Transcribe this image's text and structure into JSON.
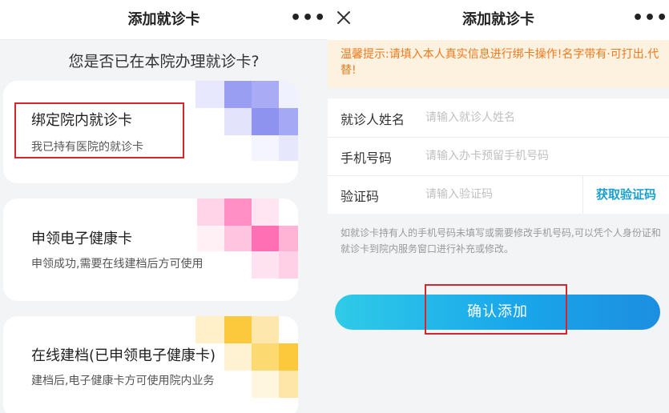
{
  "left_screen": {
    "title": "添加就诊卡",
    "more_icon": "more-horizontal-icon",
    "question": "您是否已在本院办理就诊卡?",
    "cards": [
      {
        "title": "绑定院内就诊卡",
        "desc": "我已持有医院的就诊卡",
        "accent": "#8f93f0"
      },
      {
        "title": "申领电子健康卡",
        "desc": "申领成功,需要在线建档后方可使用",
        "accent": "#ff6fb4"
      },
      {
        "title": "在线建档(已申领电子健康卡)",
        "desc": "建档后,电子健康卡方可使用院内业务",
        "accent": "#fcc83c"
      }
    ]
  },
  "right_screen": {
    "title": "添加就诊卡",
    "close_icon": "close-icon",
    "more_icon": "more-horizontal-icon",
    "tip": "温馨提示:请填入本人真实信息进行绑卡操作!名字带有·可打出.代替!",
    "form": {
      "name_label": "就诊人姓名",
      "name_placeholder": "请输入就诊人姓名",
      "phone_label": "手机号码",
      "phone_placeholder": "请输入办卡预留手机号码",
      "code_label": "验证码",
      "code_placeholder": "请输入验证码",
      "get_code": "获取验证码"
    },
    "note": "如就诊卡持有人的手机号码未填写或需要修改手机号码,可以凭个人身份证和就诊卡到院内服务窗口进行补充或修改。",
    "confirm": "确认添加"
  },
  "colors": {
    "tip_bg": "#fdf1e0",
    "tip_text": "#ef7a1d",
    "link": "#1aa0cf",
    "highlight": "#d7262b",
    "button_gradient_start": "#2fcbe8",
    "button_gradient_end": "#1c8ee0"
  }
}
